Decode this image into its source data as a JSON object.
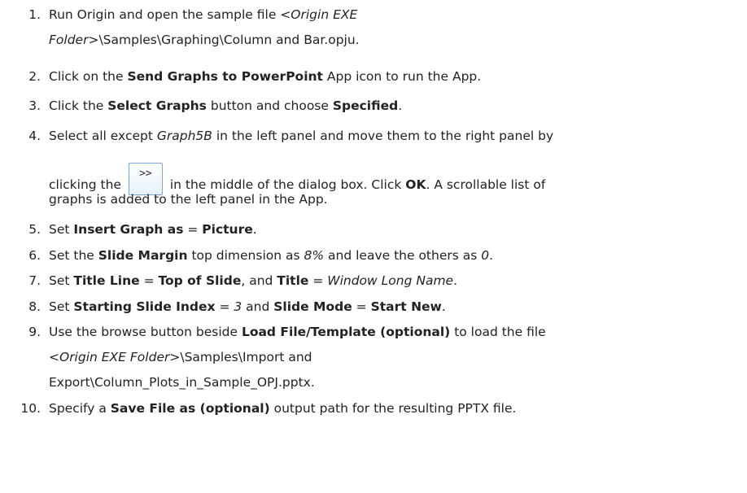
{
  "steps": [
    {
      "number": "1.",
      "lines": [
        [
          "Run Origin and open the sample file ",
          {
            "i": "<Origin EXE"
          }
        ],
        [
          {
            "i": "Folder>"
          },
          "\\Samples\\Graphing\\Column and Bar.opju."
        ]
      ]
    },
    {
      "number": "2.",
      "lines": [
        [
          "Click on the ",
          {
            "b": "Send Graphs to PowerPoint"
          },
          " App icon to run the App."
        ]
      ]
    },
    {
      "number": "3.",
      "lines": [
        [
          "Click the ",
          {
            "b": "Select Graphs"
          },
          " button and choose ",
          {
            "b": "Specified"
          },
          "."
        ]
      ]
    },
    {
      "number": "4.",
      "lines": [
        [
          "Select all except ",
          {
            "i": "Graph5B"
          },
          " in the left panel and move them to the right panel by"
        ],
        [
          "clicking the ",
          {
            "btn": ">>"
          },
          " in the middle of the dialog box. Click ",
          {
            "b": "OK"
          },
          ". A scrollable list of"
        ],
        [
          "graphs is added to the left panel in the App."
        ]
      ]
    },
    {
      "number": "5.",
      "lines": [
        [
          "Set ",
          {
            "b": "Insert Graph as"
          },
          " = ",
          {
            "b": "Picture"
          },
          "."
        ]
      ]
    },
    {
      "number": "6.",
      "lines": [
        [
          "Set the ",
          {
            "b": "Slide Margin"
          },
          " top dimension as ",
          {
            "i": "8%"
          },
          " and leave the others as ",
          {
            "i": "0"
          },
          "."
        ]
      ]
    },
    {
      "number": "7.",
      "lines": [
        [
          "Set ",
          {
            "b": "Title Line"
          },
          " = ",
          {
            "b": "Top of Slide"
          },
          ", and ",
          {
            "b": "Title"
          },
          " = ",
          {
            "i": "Window Long Name"
          },
          "."
        ]
      ]
    },
    {
      "number": "8.",
      "lines": [
        [
          "Set ",
          {
            "b": "Starting Slide Index"
          },
          " = ",
          {
            "i": "3"
          },
          " and ",
          {
            "b": "Slide Mode"
          },
          " = ",
          {
            "b": "Start New"
          },
          "."
        ]
      ]
    },
    {
      "number": "9.",
      "lines": [
        [
          "Use the browse button beside ",
          {
            "b": "Load File/Template (optional)"
          },
          " to load the file"
        ],
        [
          {
            "i": "<Origin EXE Folder>"
          },
          "\\Samples\\Import and"
        ],
        [
          "Export\\Column_Plots_in_Sample_OPJ.pptx."
        ]
      ]
    },
    {
      "number": "10.",
      "lines": [
        [
          "Specify a ",
          {
            "b": "Save File as (optional)"
          },
          " output path for the resulting PPTX file."
        ]
      ]
    }
  ]
}
